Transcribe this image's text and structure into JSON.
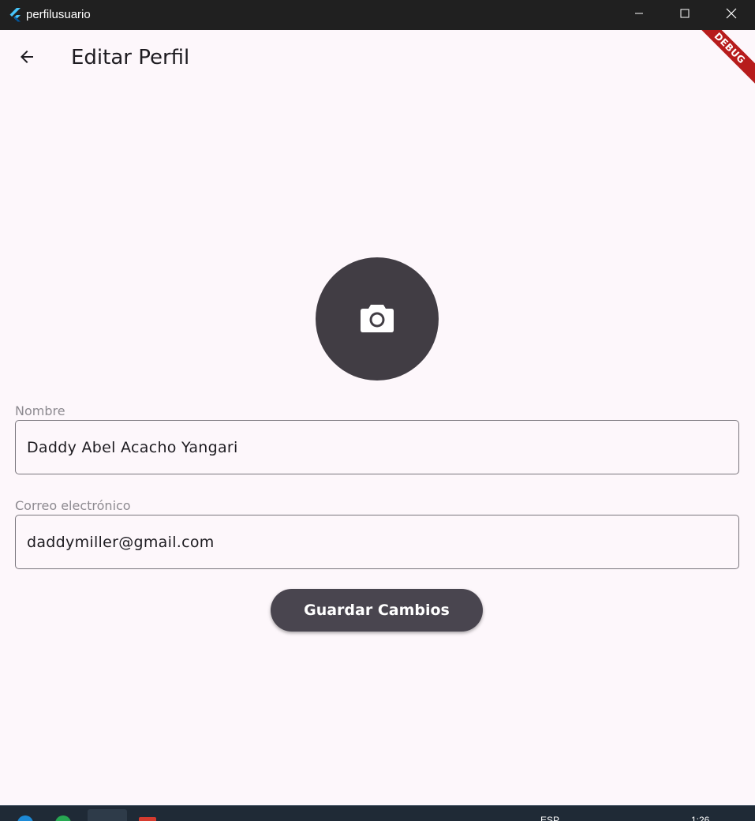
{
  "window": {
    "title": "perfilusuario",
    "icons": {
      "app": "flutter-icon",
      "minimize": "minimize-icon",
      "maximize": "maximize-icon",
      "close": "close-icon"
    }
  },
  "app_bar": {
    "title": "Editar Perfil",
    "back_icon": "arrow-back-icon",
    "debug_banner": "DEBUG"
  },
  "avatar": {
    "icon": "camera-icon"
  },
  "form": {
    "nombre": {
      "label": "Nombre",
      "value": "Daddy Abel Acacho Yangari"
    },
    "correo": {
      "label": "Correo electrónico",
      "value": "daddymiller@gmail.com"
    },
    "save_label": "Guardar Cambios"
  },
  "taskbar": {
    "language": "ESP",
    "clock": "1:26"
  },
  "colors": {
    "background": "#fdf7fb",
    "avatar": "#413d44",
    "button": "#49454f",
    "debug": "#b71c1c",
    "titlebar": "#202020"
  }
}
